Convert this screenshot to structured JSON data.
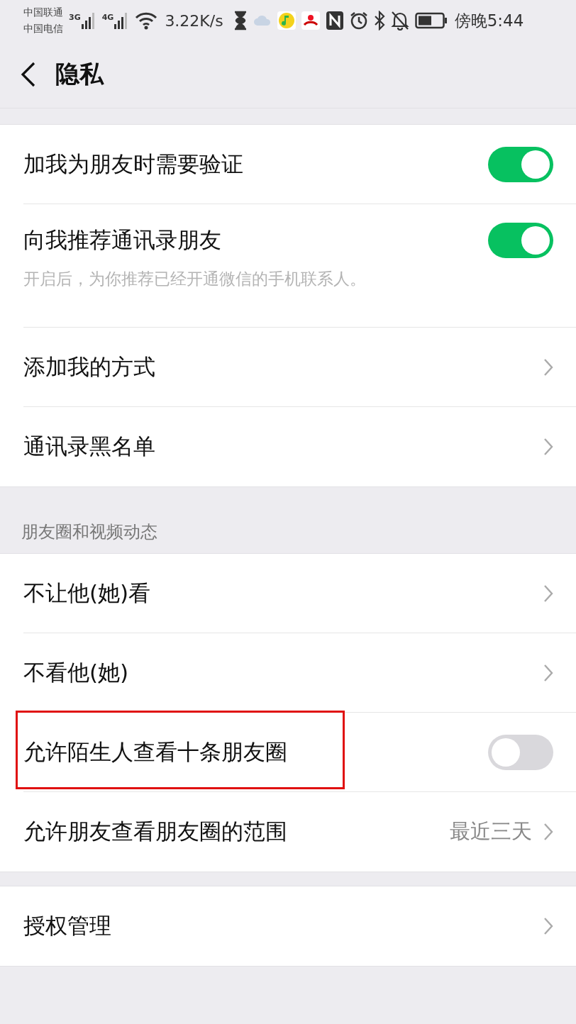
{
  "status_bar": {
    "carriers": [
      "中国联通",
      "中国电信"
    ],
    "network_labels": [
      "3G",
      "4G"
    ],
    "speed": "3.22K/s",
    "time": "傍晚5:44"
  },
  "nav": {
    "title": "隐私"
  },
  "groups": [
    {
      "items": [
        {
          "kind": "toggle",
          "label": "加我为朋友时需要验证",
          "on": true,
          "highlighted": false
        },
        {
          "kind": "toggle",
          "label": "向我推荐通讯录朋友",
          "on": true,
          "description": "开启后，为你推荐已经开通微信的手机联系人。",
          "highlighted": false
        },
        {
          "kind": "link",
          "label": "添加我的方式",
          "highlighted": false
        },
        {
          "kind": "link",
          "label": "通讯录黑名单",
          "highlighted": false
        }
      ]
    },
    {
      "header": "朋友圈和视频动态",
      "items": [
        {
          "kind": "link",
          "label": "不让他(她)看",
          "highlighted": false
        },
        {
          "kind": "link",
          "label": "不看他(她)",
          "highlighted": false
        },
        {
          "kind": "toggle",
          "label": "允许陌生人查看十条朋友圈",
          "on": false,
          "highlighted": true
        },
        {
          "kind": "link",
          "label": "允许朋友查看朋友圈的范围",
          "value": "最近三天",
          "highlighted": false
        }
      ]
    },
    {
      "items": [
        {
          "kind": "link",
          "label": "授权管理",
          "highlighted": false
        }
      ]
    }
  ]
}
